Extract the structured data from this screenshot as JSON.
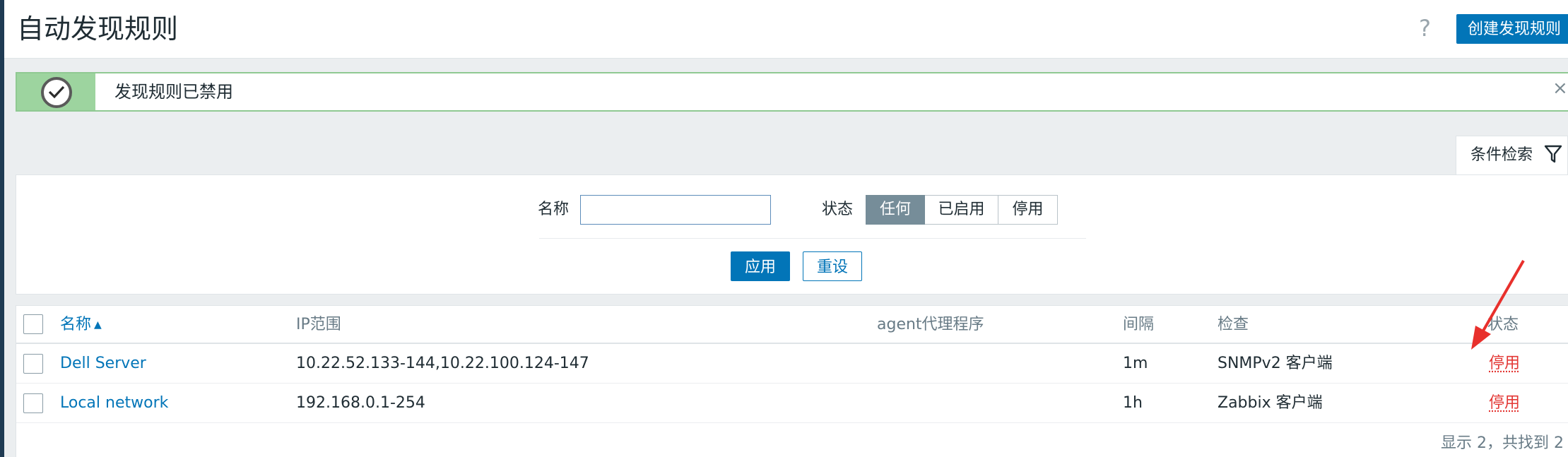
{
  "header": {
    "title": "自动发现规则",
    "help_icon": "?",
    "create_button": "创建发现规则"
  },
  "message": {
    "text": "发现规则已禁用",
    "close": "×",
    "icon": "check-icon",
    "color": "#9dd49f"
  },
  "filter": {
    "tab_label": "条件检索",
    "name_label": "名称",
    "name_value": "",
    "status_label": "状态",
    "status_options": [
      "任何",
      "已启用",
      "停用"
    ],
    "status_selected": "任何",
    "apply_button": "应用",
    "reset_button": "重设"
  },
  "table": {
    "columns": [
      "名称",
      "IP范围",
      "agent代理程序",
      "间隔",
      "检查",
      "状态"
    ],
    "sort_column": "名称",
    "rows": [
      {
        "name": "Dell Server",
        "ip_range": "10.22.52.133-144,10.22.100.124-147",
        "proxy": "",
        "interval": "1m",
        "checks": "SNMPv2 客户端",
        "status": "停用"
      },
      {
        "name": "Local network",
        "ip_range": "192.168.0.1-254",
        "proxy": "",
        "interval": "1h",
        "checks": "Zabbix 客户端",
        "status": "停用"
      }
    ],
    "footer": "显示 2，共找到 2"
  },
  "colors": {
    "accent": "#0275b8",
    "disabled_status": "#e33734",
    "active_segment": "#768d99"
  }
}
